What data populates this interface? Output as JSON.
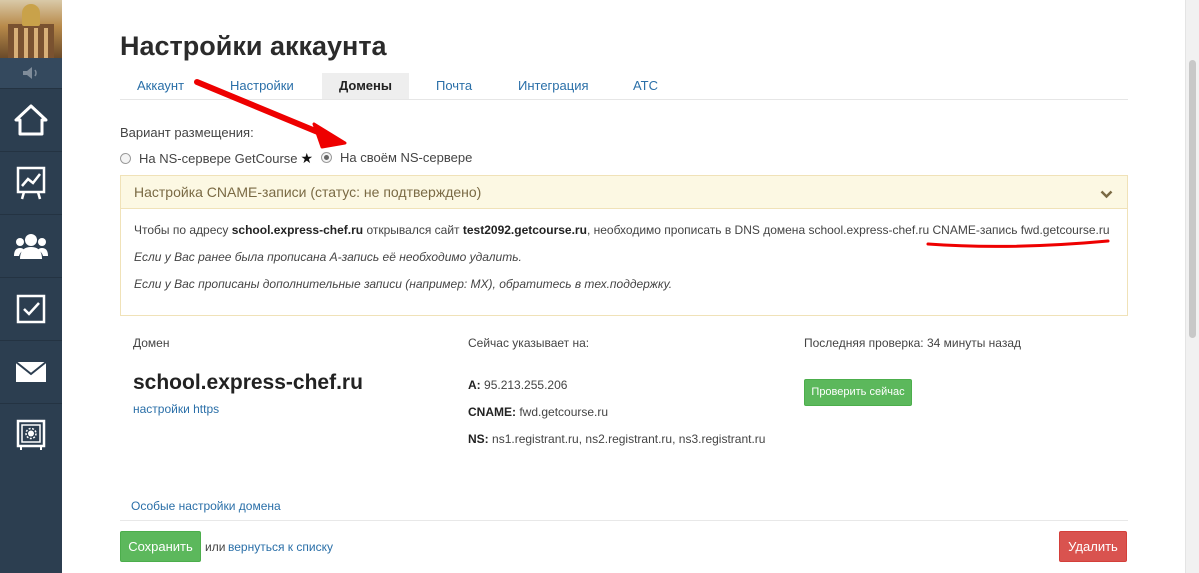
{
  "sidebar": {
    "items": [
      {
        "icon": "home-icon"
      },
      {
        "icon": "chart-icon"
      },
      {
        "icon": "users-icon"
      },
      {
        "icon": "tasks-icon"
      },
      {
        "icon": "mail-icon"
      },
      {
        "icon": "settings-safe-icon"
      }
    ]
  },
  "page": {
    "title": "Настройки аккаунта",
    "tabs": [
      {
        "label": "Аккаунт",
        "active": false
      },
      {
        "label": "Настройки",
        "active": false
      },
      {
        "label": "Домены",
        "active": true
      },
      {
        "label": "Почта",
        "active": false
      },
      {
        "label": "Интеграция",
        "active": false
      },
      {
        "label": "АТС",
        "active": false
      }
    ]
  },
  "placement": {
    "label": "Вариант размещения:",
    "options": [
      {
        "label": "На NS-сервере GetCourse",
        "star": "★",
        "checked": false
      },
      {
        "label": "На своём NS-сервере",
        "checked": true
      }
    ]
  },
  "cname": {
    "header": "Настройка CNAME-записи (статус: не подтверждено)",
    "line1": {
      "t1": "Чтобы по адресу ",
      "b1": "school.express-chef.ru",
      "t2": " открывался сайт ",
      "b2": "test2092.getcourse.ru",
      "t3": ", необходимо прописать в DNS домена school.express-chef.ru CNAME-запись fwd.getcourse.ru"
    },
    "line2": "Если у Вас ранее была прописана A-запись её необходимо удалить.",
    "line3": "Если у Вас прописаны дополнительные записи (например: MX), обратитесь в тех.поддержку."
  },
  "domain": {
    "col_domain": "Домен",
    "col_points": "Сейчас указывает на:",
    "col_check": "Последняя проверка: 34 минуты назад",
    "name": "school.express-chef.ru",
    "https_link": "настройки https",
    "a_label": "A:",
    "a_value": "95.213.255.206",
    "cname_label": "CNAME:",
    "cname_value": "fwd.getcourse.ru",
    "ns_label": "NS:",
    "ns_value": "ns1.registrant.ru, ns2.registrant.ru, ns3.registrant.ru",
    "check_button": "Проверить сейчас",
    "special_link": "Особые настройки домена"
  },
  "footer": {
    "save_button": "Сохранить",
    "or_text": "или",
    "back_link": "вернуться к списку",
    "delete_button": "Удалить"
  },
  "colors": {
    "sidebar": "#2c3e50",
    "link": "#2a6fa8",
    "green": "#5cb85c",
    "red": "#d9534f",
    "warning_bg": "#fcf8e3",
    "annotation": "#ee0000"
  }
}
